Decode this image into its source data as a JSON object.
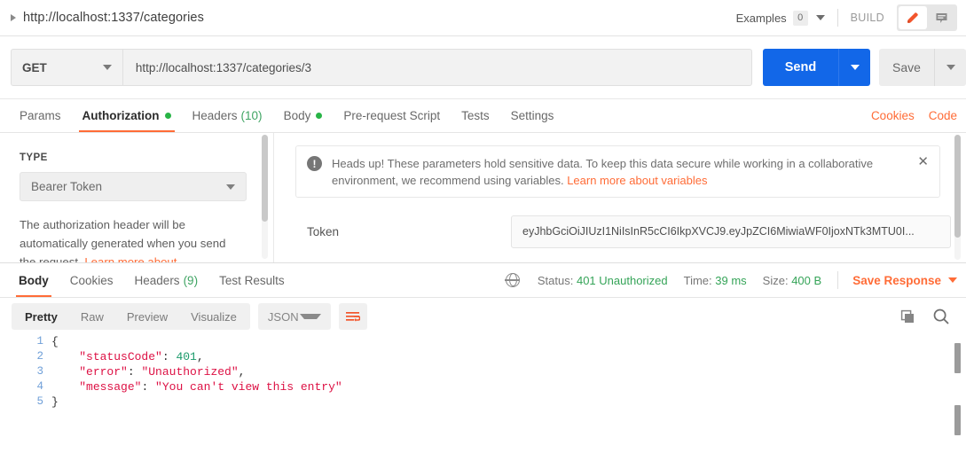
{
  "titlebar": {
    "request_name": "http://localhost:1337/categories",
    "examples_label": "Examples",
    "examples_count": "0",
    "build_label": "BUILD",
    "edit_icon": "pencil-icon",
    "comment_icon": "comment-icon"
  },
  "urlbar": {
    "method": "GET",
    "url": "http://localhost:1337/categories/3",
    "send_label": "Send",
    "save_label": "Save"
  },
  "request_tabs": {
    "items": [
      {
        "label": "Params",
        "active": false,
        "dot": false,
        "count": ""
      },
      {
        "label": "Authorization",
        "active": true,
        "dot": true,
        "count": ""
      },
      {
        "label": "Headers",
        "active": false,
        "dot": false,
        "count": "(10)"
      },
      {
        "label": "Body",
        "active": false,
        "dot": true,
        "count": ""
      },
      {
        "label": "Pre-request Script",
        "active": false,
        "dot": false,
        "count": ""
      },
      {
        "label": "Tests",
        "active": false,
        "dot": false,
        "count": ""
      },
      {
        "label": "Settings",
        "active": false,
        "dot": false,
        "count": ""
      }
    ],
    "cookies_link": "Cookies",
    "code_link": "Code"
  },
  "auth": {
    "type_label": "TYPE",
    "type_value": "Bearer Token",
    "description_text": "The authorization header will be automatically generated when you send the request. ",
    "description_link": "Learn more about",
    "notice_text": "Heads up! These parameters hold sensitive data. To keep this data secure while working in a collaborative environment, we recommend using variables. ",
    "notice_link": "Learn more about variables",
    "notice_close": "✕",
    "token_label": "Token",
    "token_value": "eyJhbGciOiJIUzI1NiIsInR5cCI6IkpXVCJ9.eyJpZCI6MiwiaWF0IjoxNTk3MTU0I..."
  },
  "response_tabs": {
    "items": [
      {
        "label": "Body",
        "active": true,
        "count": ""
      },
      {
        "label": "Cookies",
        "active": false,
        "count": ""
      },
      {
        "label": "Headers",
        "active": false,
        "count": "(9)"
      },
      {
        "label": "Test Results",
        "active": false,
        "count": ""
      }
    ],
    "globe_icon": "globe-icon",
    "status_label": "Status:",
    "status_value": "401 Unauthorized",
    "time_label": "Time:",
    "time_value": "39 ms",
    "size_label": "Size:",
    "size_value": "400 B",
    "save_response_label": "Save Response"
  },
  "body_toolbar": {
    "views": [
      {
        "label": "Pretty",
        "active": true
      },
      {
        "label": "Raw",
        "active": false
      },
      {
        "label": "Preview",
        "active": false
      },
      {
        "label": "Visualize",
        "active": false
      }
    ],
    "language": "JSON",
    "wrap_icon": "word-wrap-icon",
    "copy_icon": "copy-icon",
    "search_icon": "search-icon"
  },
  "response_body": {
    "lines": [
      {
        "num": "1",
        "indent": 0,
        "segments": [
          {
            "t": "{",
            "c": "tk-brace"
          }
        ]
      },
      {
        "num": "2",
        "indent": 4,
        "segments": [
          {
            "t": "\"statusCode\"",
            "c": "tk-key"
          },
          {
            "t": ": ",
            "c": "tk-punc"
          },
          {
            "t": "401",
            "c": "tk-num"
          },
          {
            "t": ",",
            "c": "tk-punc"
          }
        ]
      },
      {
        "num": "3",
        "indent": 4,
        "segments": [
          {
            "t": "\"error\"",
            "c": "tk-key"
          },
          {
            "t": ": ",
            "c": "tk-punc"
          },
          {
            "t": "\"Unauthorized\"",
            "c": "tk-str"
          },
          {
            "t": ",",
            "c": "tk-punc"
          }
        ]
      },
      {
        "num": "4",
        "indent": 4,
        "segments": [
          {
            "t": "\"message\"",
            "c": "tk-key"
          },
          {
            "t": ": ",
            "c": "tk-punc"
          },
          {
            "t": "\"You can't view this entry\"",
            "c": "tk-str"
          }
        ]
      },
      {
        "num": "5",
        "indent": 0,
        "segments": [
          {
            "t": "}",
            "c": "tk-brace"
          }
        ]
      }
    ]
  },
  "colors": {
    "accent_orange": "#ff6c37",
    "send_blue": "#1267e8",
    "status_green": "#35a458",
    "dot_green": "#28b446"
  }
}
